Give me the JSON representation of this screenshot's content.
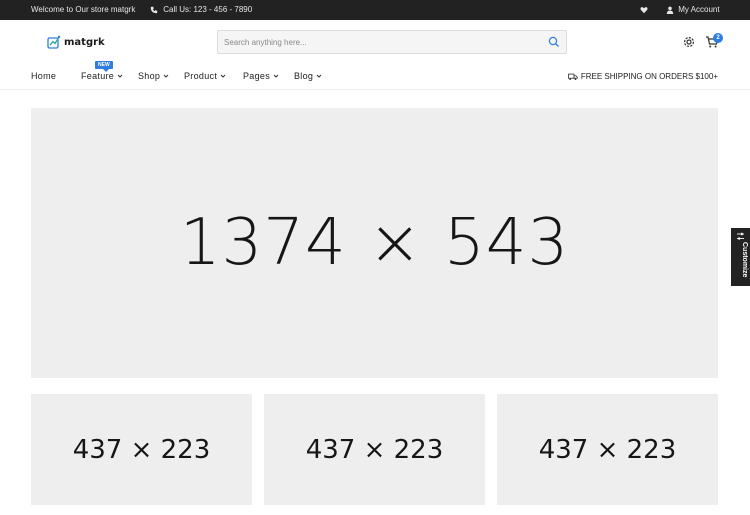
{
  "topbar": {
    "welcome": "Welcome to Our store matgrk",
    "phone": "Call Us: 123 - 456 - 7890",
    "account": "My Account"
  },
  "header": {
    "logo_text": "matgrk",
    "search_placeholder": "Search anything here...",
    "cart_count": "2"
  },
  "nav": {
    "items": [
      {
        "label": "Home",
        "dropdown": false
      },
      {
        "label": "Feature",
        "dropdown": true,
        "badge": "NEW"
      },
      {
        "label": "Shop",
        "dropdown": true
      },
      {
        "label": "Product",
        "dropdown": true
      },
      {
        "label": "Pages",
        "dropdown": true
      },
      {
        "label": "Blog",
        "dropdown": true
      }
    ],
    "shipping": "FREE SHIPPING ON ORDERS $100+"
  },
  "banner": {
    "label": "1374 × 543"
  },
  "tiles": [
    {
      "label": "437 × 223"
    },
    {
      "label": "437 × 223"
    },
    {
      "label": "437 × 223"
    }
  ],
  "customize": {
    "label": "Customize"
  },
  "colors": {
    "accent": "#2f7de1",
    "topbar_bg": "#222222",
    "placeholder_bg": "#eeeeee"
  }
}
